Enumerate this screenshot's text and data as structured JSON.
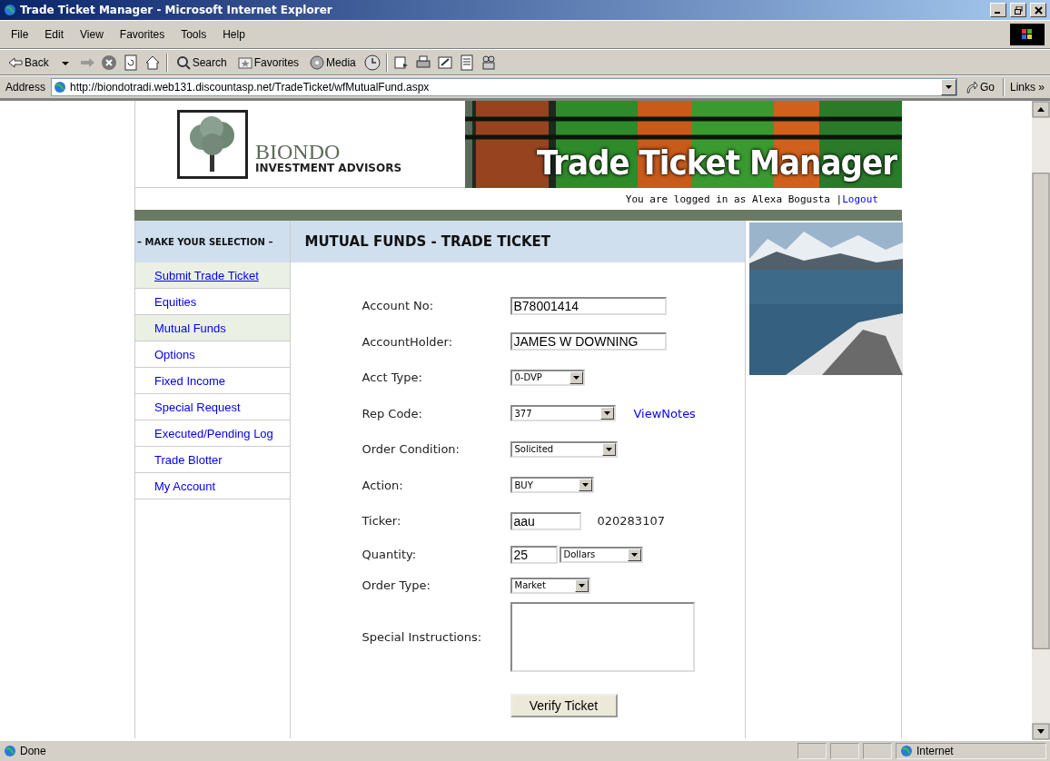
{
  "window": {
    "title": "Trade Ticket Manager - Microsoft Internet Explorer"
  },
  "menu": [
    "File",
    "Edit",
    "View",
    "Favorites",
    "Tools",
    "Help"
  ],
  "toolbar": {
    "back": "Back",
    "search": "Search",
    "favorites": "Favorites",
    "media": "Media"
  },
  "address": {
    "label": "Address",
    "url": "http://biondotradi.web131.discountasp.net/TradeTicket/wfMutualFund.aspx",
    "go": "Go",
    "links": "Links »"
  },
  "header": {
    "brand": "BIONDO",
    "brand_sub": "INVESTMENT ADVISORS",
    "banner_title": "Trade Ticket Manager",
    "login_text": "You are logged in as Alexa Bogusta |",
    "logout": "Logout"
  },
  "sidebar": {
    "title": "– MAKE YOUR SELECTION –",
    "items": [
      {
        "label": "Submit Trade Ticket",
        "highlighted": true,
        "underlined": true
      },
      {
        "label": "Equities",
        "highlighted": false,
        "underlined": false
      },
      {
        "label": "Mutual Funds",
        "highlighted": true,
        "underlined": false
      },
      {
        "label": "Options",
        "highlighted": false,
        "underlined": false
      },
      {
        "label": "Fixed Income",
        "highlighted": false,
        "underlined": false
      },
      {
        "label": "Special Request",
        "highlighted": false,
        "underlined": false
      },
      {
        "label": "Executed/Pending Log",
        "highlighted": false,
        "underlined": false
      },
      {
        "label": "Trade Blotter",
        "highlighted": false,
        "underlined": false
      },
      {
        "label": "My Account",
        "highlighted": false,
        "underlined": false
      }
    ]
  },
  "form": {
    "title": "MUTUAL FUNDS - TRADE TICKET",
    "fields": [
      {
        "label": "Account No:",
        "kind": "text",
        "value": "B78001414"
      },
      {
        "label": "AccountHolder:",
        "kind": "text",
        "value": "JAMES W DOWNING"
      },
      {
        "label": "Acct Type:",
        "kind": "select",
        "value": "0-DVP"
      },
      {
        "label": "Rep Code:",
        "kind": "select",
        "value": "377",
        "link": "ViewNotes"
      },
      {
        "label": "Order Condition:",
        "kind": "select",
        "value": "Solicited"
      },
      {
        "label": "Action:",
        "kind": "select",
        "value": "BUY"
      },
      {
        "label": "Ticker:",
        "kind": "text",
        "value": "aau",
        "note": "020283107"
      },
      {
        "label": "Quantity:",
        "kind": "text",
        "value": "25",
        "unit": "Dollars"
      },
      {
        "label": "Order Type:",
        "kind": "select",
        "value": "Market"
      },
      {
        "label": "Special Instructions:",
        "kind": "textarea"
      }
    ],
    "button": "Verify Ticket"
  },
  "status_bar": {
    "text": "Done",
    "zone": "Internet"
  }
}
